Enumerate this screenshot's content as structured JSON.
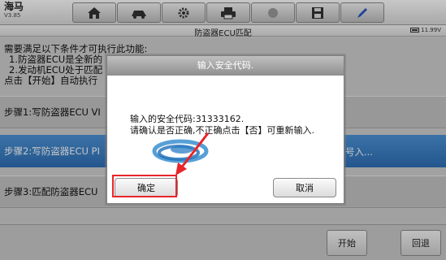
{
  "app": {
    "name": "海马",
    "version": "V3.85"
  },
  "toolbar": {
    "buttons": [
      {
        "icon": "home-icon"
      },
      {
        "icon": "car-icon"
      },
      {
        "icon": "gear-icon"
      },
      {
        "icon": "printer-icon"
      },
      {
        "icon": "help-icon"
      },
      {
        "icon": "save-icon"
      },
      {
        "icon": "pen-icon"
      }
    ]
  },
  "titlebar": {
    "title": "防盗器ECU匹配",
    "battery": "11.99V"
  },
  "info": {
    "line1": "需要满足以下条件才可执行此功能:",
    "line2": "1.防盗器ECU是全新的",
    "line3": "2.发动机ECU处于匹配",
    "line4": "点击【开始】自动执行"
  },
  "steps": {
    "step1": "步骤1:写防盗器ECU VI",
    "step2": "步骤2:写防盗器ECU PI",
    "step2_tail": "号入...",
    "step3": "步骤3:匹配防盗器ECU"
  },
  "bottom": {
    "start": "开始",
    "back": "回退"
  },
  "dialog": {
    "title": "输入安全代码.",
    "line1": "输入的安全代码:31333162.",
    "line2": "请确认是否正确,不正确点击【否】可重新输入.",
    "ok": "确定",
    "cancel": "取消"
  },
  "colors": {
    "highlight": "#e8252a",
    "selected_step": "#3a80c6"
  }
}
